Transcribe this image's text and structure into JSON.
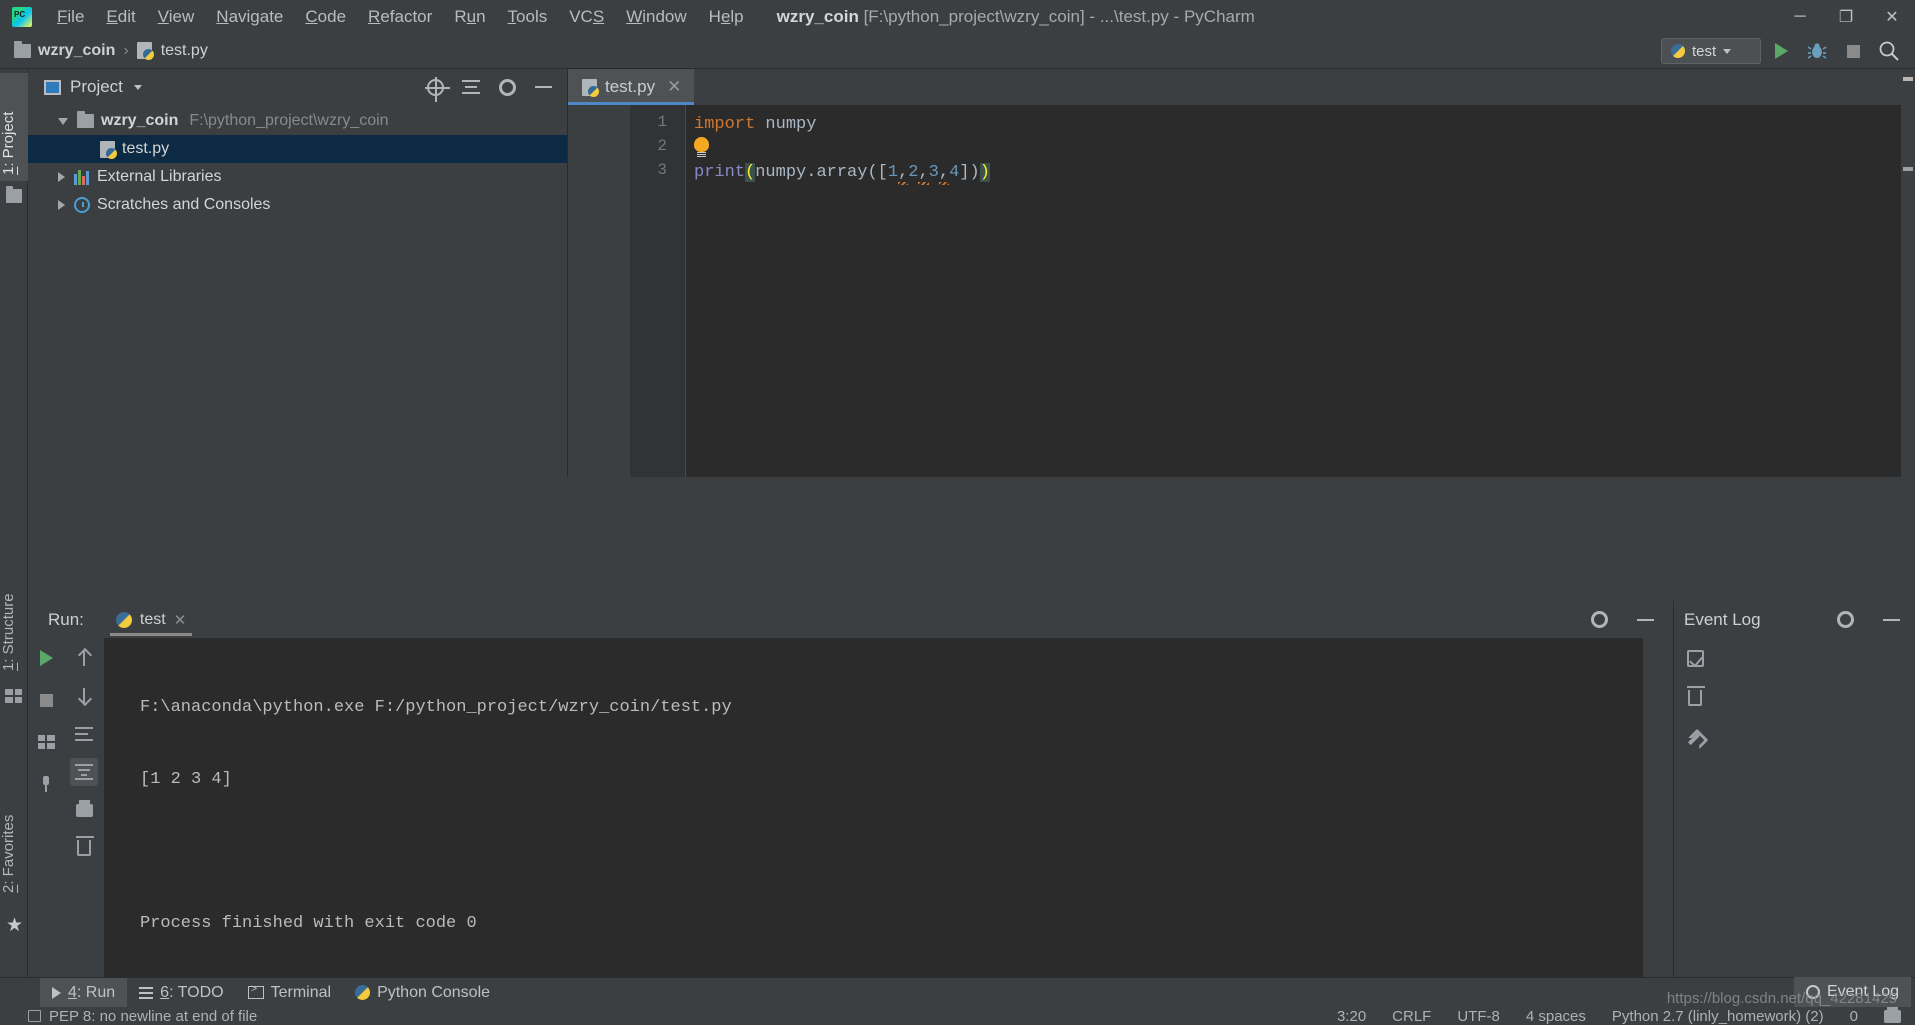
{
  "window": {
    "app_name": "PyCharm",
    "title_project": "wzry_coin",
    "title_path": "[F:\\python_project\\wzry_coin]",
    "title_sep1": "-",
    "title_file": "...\\test.py",
    "title_sep2": "-",
    "logo_text": "PC",
    "minimize": "─",
    "maximize": "❐",
    "close": "✕"
  },
  "menubar": {
    "items": [
      {
        "name": "file",
        "pre": "",
        "key": "F",
        "post": "ile"
      },
      {
        "name": "edit",
        "pre": "",
        "key": "E",
        "post": "dit"
      },
      {
        "name": "view",
        "pre": "",
        "key": "V",
        "post": "iew"
      },
      {
        "name": "navigate",
        "pre": "",
        "key": "N",
        "post": "avigate"
      },
      {
        "name": "code",
        "pre": "",
        "key": "C",
        "post": "ode"
      },
      {
        "name": "refactor",
        "pre": "",
        "key": "R",
        "post": "efactor"
      },
      {
        "name": "run",
        "pre": "R",
        "key": "u",
        "post": "n"
      },
      {
        "name": "tools",
        "pre": "",
        "key": "T",
        "post": "ools"
      },
      {
        "name": "vcs",
        "pre": "VC",
        "key": "S",
        "post": ""
      },
      {
        "name": "window",
        "pre": "",
        "key": "W",
        "post": "indow"
      },
      {
        "name": "help",
        "pre": "H",
        "key": "e",
        "post": "lp"
      }
    ]
  },
  "breadcrumb": {
    "project": "wzry_coin",
    "separator": "›",
    "file": "test.py"
  },
  "navbar_right": {
    "run_config": "test",
    "run_tooltip": "Run",
    "debug_tooltip": "Debug",
    "stop_tooltip": "Stop",
    "search_tooltip": "Search Everywhere"
  },
  "left_strip": {
    "project_tab_pre": "1",
    "project_tab_post": ": Project",
    "structure_tab_pre": "1",
    "structure_tab_post": ": Structure",
    "favorites_tab_pre": "2",
    "favorites_tab_post": ": Favorites"
  },
  "project_panel": {
    "title": "Project",
    "tree": [
      {
        "name": "wzry_coin",
        "label": "wzry_coin",
        "path": "F:\\python_project\\wzry_coin",
        "arrow": "down",
        "icon": "folder-icon",
        "indent": 0,
        "selected": false,
        "bold": true
      },
      {
        "name": "test-py",
        "label": "test.py",
        "path": "",
        "arrow": "none",
        "icon": "python-file-icon",
        "indent": 1,
        "selected": true,
        "bold": false
      },
      {
        "name": "external-libraries",
        "label": "External Libraries",
        "path": "",
        "arrow": "right",
        "icon": "library-icon",
        "indent": 0,
        "selected": false,
        "bold": false
      },
      {
        "name": "scratches-and-consoles",
        "label": "Scratches and Consoles",
        "path": "",
        "arrow": "right",
        "icon": "scratches-icon",
        "indent": 0,
        "selected": false,
        "bold": false
      }
    ]
  },
  "editor": {
    "tab_label": "test.py",
    "tab_close": "✕",
    "lines": [
      {
        "num": "1"
      },
      {
        "num": "2"
      },
      {
        "num": "3"
      }
    ],
    "line1": {
      "kw": "import",
      "space": " ",
      "mod": "numpy"
    },
    "line3": {
      "fn": "print",
      "open_paren_matched": "(",
      "mod": "numpy",
      "dot": ".",
      "method": "array",
      "open2": "([",
      "n1": "1",
      "c1": ",",
      "n2": "2",
      "c2": ",",
      "n3": "3",
      "c3": ",",
      "n4": "4",
      "close1": "])",
      "close_paren_matched": ")"
    }
  },
  "run_panel": {
    "label": "Run:",
    "tab_name": "test",
    "tab_close": "✕",
    "console_lines": [
      "F:\\anaconda\\python.exe F:/python_project/wzry_coin/test.py",
      "[1 2 3 4]",
      "",
      "Process finished with exit code 0"
    ],
    "buttons": {
      "rerun": "Rerun",
      "stop": "Stop",
      "up": "Up the stack trace",
      "down": "Down the stack trace",
      "soft_wrap": "Soft-Wrap",
      "scroll_end": "Scroll to end",
      "print": "Print",
      "clear_all": "Clear All",
      "pin": "Pin Tab"
    }
  },
  "event_log": {
    "title": "Event Log",
    "settings": "Settings",
    "hide": "Hide",
    "mark_read": "Mark all as read",
    "clear": "Clear All",
    "configure": "Configure"
  },
  "bottom_bar": {
    "items": [
      {
        "name": "run",
        "pre": "",
        "key": "4",
        "post": ": Run",
        "icon": "play-icon",
        "active": true
      },
      {
        "name": "todo",
        "pre": "",
        "key": "6",
        "post": ": TODO",
        "icon": "list-icon",
        "active": false
      },
      {
        "name": "terminal",
        "pre": "Terminal",
        "key": "",
        "post": "",
        "icon": "terminal-icon",
        "active": false
      },
      {
        "name": "python-console",
        "pre": "Python Console",
        "key": "",
        "post": "",
        "icon": "python-icon",
        "active": false
      }
    ],
    "event_log_button": "Event Log"
  },
  "status_bar": {
    "inspection": "PEP 8: no newline at end of file",
    "caret": "3:20",
    "line_sep": "CRLF",
    "encoding": "UTF-8",
    "indent": "4 spaces",
    "interpreter": "Python 2.7 (linly_homework) (2)",
    "branch": "0"
  },
  "watermark": {
    "url": "https://blog.csdn.net/qq_42281425"
  },
  "colors": {
    "bg_chrome": "#3c3f41",
    "bg_editor": "#2b2b2b",
    "bg_gutter": "#313335",
    "selection_blue": "#0d2a45",
    "tab_accent": "#4a88c7",
    "keyword_orange": "#cc7832",
    "number_blue": "#6897bb",
    "function_purple": "#8888c6",
    "default_text": "#a9b7c6",
    "run_green": "#59a869",
    "bulb_yellow": "#f5a623",
    "match_bracket": "#3b514d"
  }
}
